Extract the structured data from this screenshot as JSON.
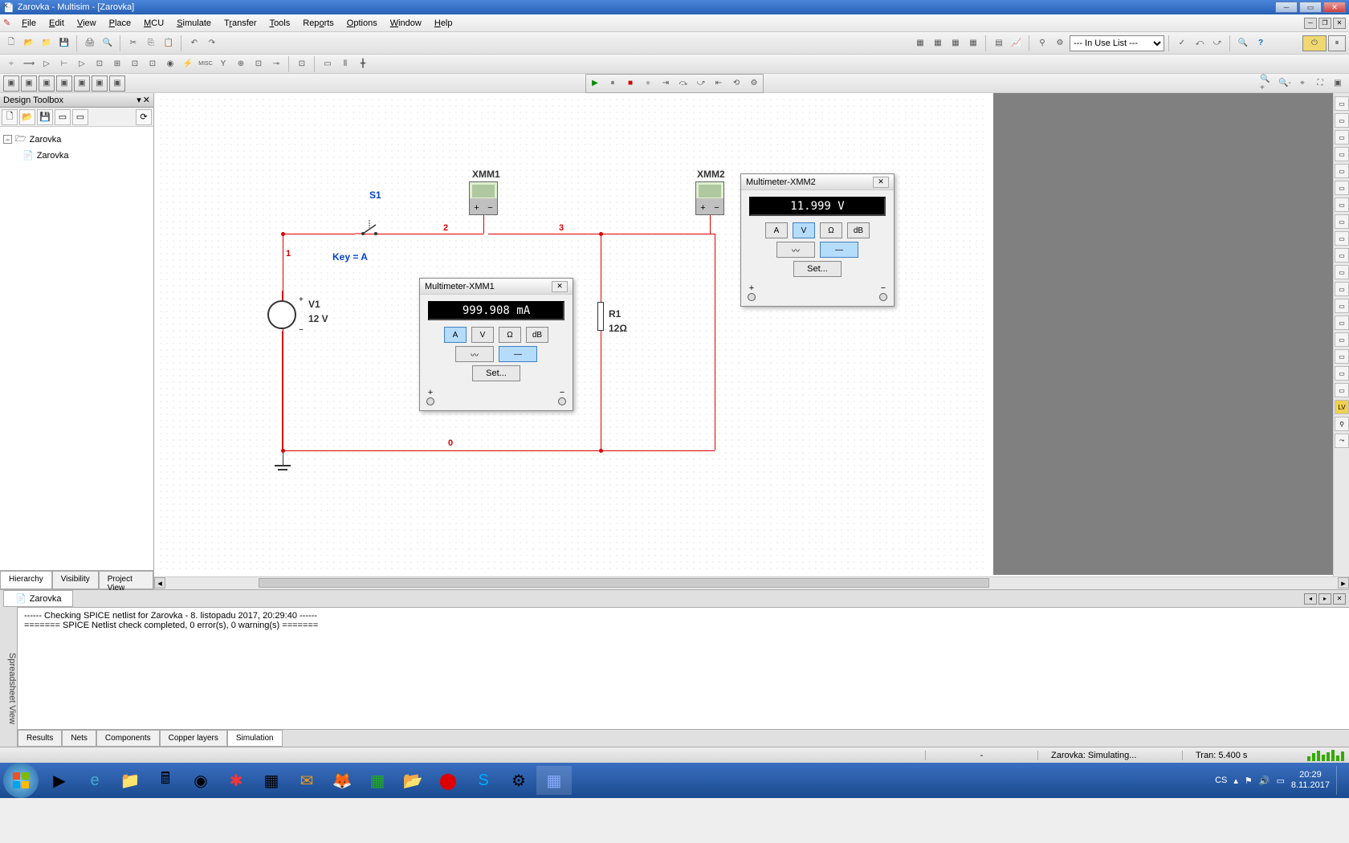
{
  "app": {
    "title": "Zarovka - Multisim - [Zarovka]"
  },
  "menu": {
    "file": "File",
    "edit": "Edit",
    "view": "View",
    "place": "Place",
    "mcu": "MCU",
    "simulate": "Simulate",
    "transfer": "Transfer",
    "tools": "Tools",
    "reports": "Reports",
    "options": "Options",
    "window": "Window",
    "help": "Help"
  },
  "toolbar": {
    "list_select": "--- In Use List ---"
  },
  "design_toolbox": {
    "title": "Design Toolbox",
    "root": "Zarovka",
    "child": "Zarovka",
    "tabs": {
      "hierarchy": "Hierarchy",
      "visibility": "Visibility",
      "project": "Project View"
    }
  },
  "canvas": {
    "doc_tab": "Zarovka",
    "labels": {
      "s1": "S1",
      "key": "Key = A",
      "v1": "V1",
      "v1_val": "12 V",
      "r1": "R1",
      "r1_val": "12Ω",
      "xmm1": "XMM1",
      "xmm2": "XMM2",
      "n0": "0",
      "n1": "1",
      "n2": "2",
      "n3": "3"
    }
  },
  "xmm1": {
    "title": "Multimeter-XMM1",
    "display": "999.908 mA",
    "btn_a": "A",
    "btn_v": "V",
    "btn_ohm": "Ω",
    "btn_db": "dB",
    "set": "Set..."
  },
  "xmm2": {
    "title": "Multimeter-XMM2",
    "display": "11.999 V",
    "btn_a": "A",
    "btn_v": "V",
    "btn_ohm": "Ω",
    "btn_db": "dB",
    "set": "Set..."
  },
  "log": {
    "label": "Spreadsheet View",
    "line1": "------ Checking SPICE netlist for Zarovka - 8. listopadu 2017, 20:29:40 ------",
    "line2": "======= SPICE Netlist check completed, 0 error(s), 0 warning(s) =======",
    "tabs": {
      "results": "Results",
      "nets": "Nets",
      "components": "Components",
      "copper": "Copper layers",
      "simulation": "Simulation"
    }
  },
  "status": {
    "sim": "Zarovka: Simulating...",
    "tran": "Tran: 5.400 s"
  },
  "task": {
    "lang": "CS",
    "time": "20:29",
    "date": "8.11.2017"
  }
}
